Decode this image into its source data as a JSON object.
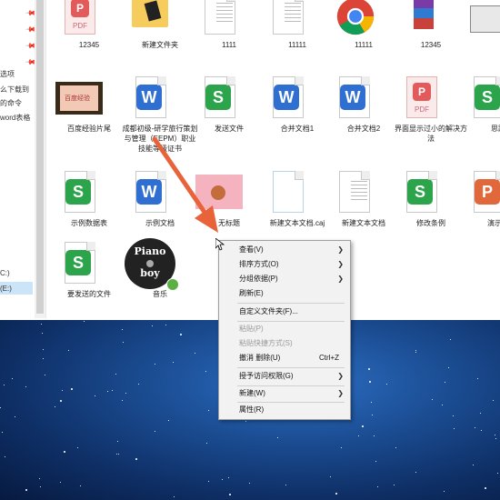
{
  "sidebar": {
    "items": [
      {
        "label": "选项"
      },
      {
        "label": "么下载到"
      },
      {
        "label": "的命令"
      },
      {
        "label": "word表格"
      },
      {
        "label": "C:)"
      },
      {
        "label": "(E:)"
      }
    ]
  },
  "files": [
    {
      "label": "12345",
      "icon": "pdf-icon"
    },
    {
      "label": "新建文件夹",
      "icon": "folder-icon"
    },
    {
      "label": "1111",
      "icon": "text-doc-icon"
    },
    {
      "label": "11111",
      "icon": "text-doc-icon"
    },
    {
      "label": "11111",
      "icon": "chrome-icon"
    },
    {
      "label": "12345",
      "icon": "archive-icon"
    },
    {
      "label": "",
      "icon": "image-icon"
    },
    {
      "label": "百度经验片尾",
      "icon": "video-icon"
    },
    {
      "label": "成都初级-研学旅行策划与管理（EEPM）职业技能等级证书",
      "icon": "word-doc-icon"
    },
    {
      "label": "发送文件",
      "icon": "wps-sheet-icon"
    },
    {
      "label": "合并文档1",
      "icon": "word-doc-icon"
    },
    {
      "label": "合并文档2",
      "icon": "word-doc-icon"
    },
    {
      "label": "界面显示过小的解决方法",
      "icon": "pdf-icon"
    },
    {
      "label": "思路",
      "icon": "wps-sheet-icon"
    },
    {
      "label": "示例数据表",
      "icon": "wps-sheet-icon"
    },
    {
      "label": "示例文档",
      "icon": "word-doc-icon"
    },
    {
      "label": "无标题",
      "icon": "image-icon"
    },
    {
      "label": "新建文本文档.caj",
      "icon": "blank-doc-icon"
    },
    {
      "label": "新建文本文档",
      "icon": "text-doc-icon"
    },
    {
      "label": "修改条例",
      "icon": "wps-sheet-icon"
    },
    {
      "label": "演示文",
      "icon": "presentation-icon"
    },
    {
      "label": "要发送的文件",
      "icon": "wps-sheet-icon"
    },
    {
      "label": "音乐",
      "icon": "music-cd-icon"
    }
  ],
  "music_cover": {
    "line1": "Piano",
    "line2": "boy"
  },
  "context_menu": {
    "view": "查看(V)",
    "sort": "排序方式(O)",
    "group": "分组依据(P)",
    "refresh": "刷新(E)",
    "customize": "自定义文件夹(F)...",
    "paste": "粘贴(P)",
    "paste_shortcut": "粘贴快捷方式(S)",
    "undo": "撤消 删除(U)",
    "undo_shortcut": "Ctrl+Z",
    "access": "授予访问权限(G)",
    "new": "新建(W)",
    "properties": "属性(R)"
  },
  "colors": {
    "arrow": "#e8623a",
    "wps_green": "#2ca44c",
    "word_blue": "#2f6fd2"
  }
}
